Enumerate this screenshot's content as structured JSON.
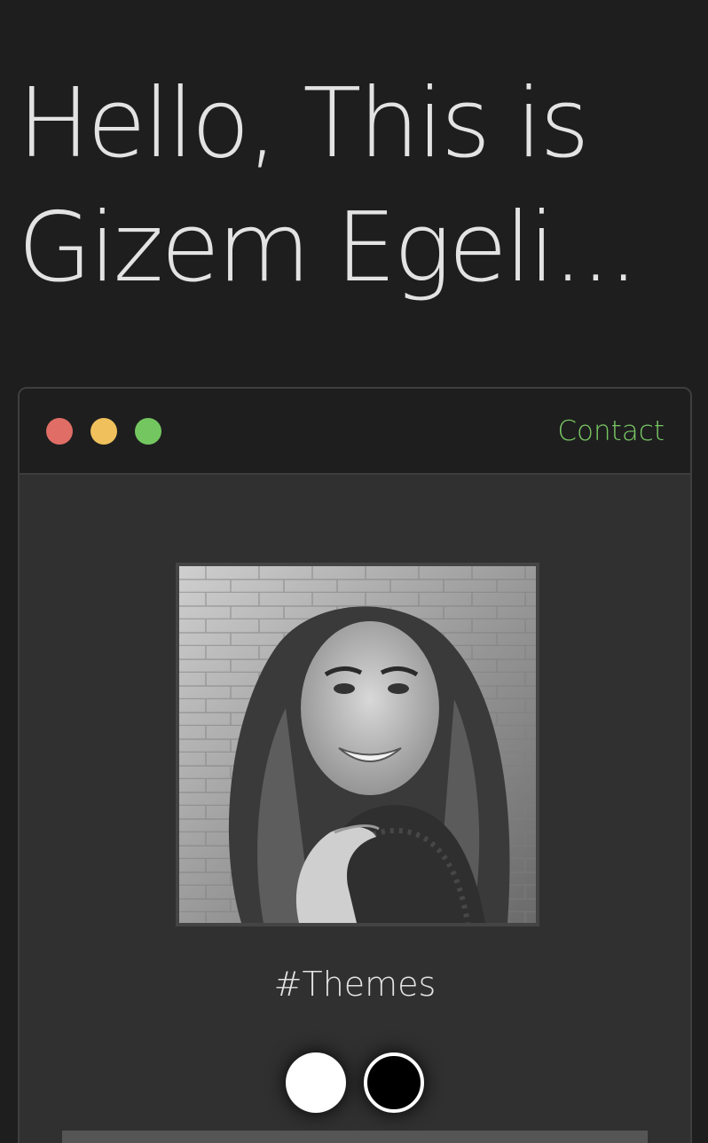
{
  "hero": {
    "line1": "Hello, This is",
    "line2": "Gizem Egeli..."
  },
  "window": {
    "nav_link": "Contact",
    "traffic_lights": [
      "red",
      "yellow",
      "green"
    ]
  },
  "profile": {
    "photo_icon": "portrait-photo"
  },
  "themes": {
    "heading": "#Themes",
    "options": [
      "light",
      "dark"
    ]
  },
  "colors": {
    "background": "#1e1e1f",
    "window_body": "#303031",
    "accent": "#79c763",
    "close": "#e06e66",
    "minimize": "#f0c05c",
    "maximize": "#74c760",
    "text": "#e3e3e3"
  }
}
